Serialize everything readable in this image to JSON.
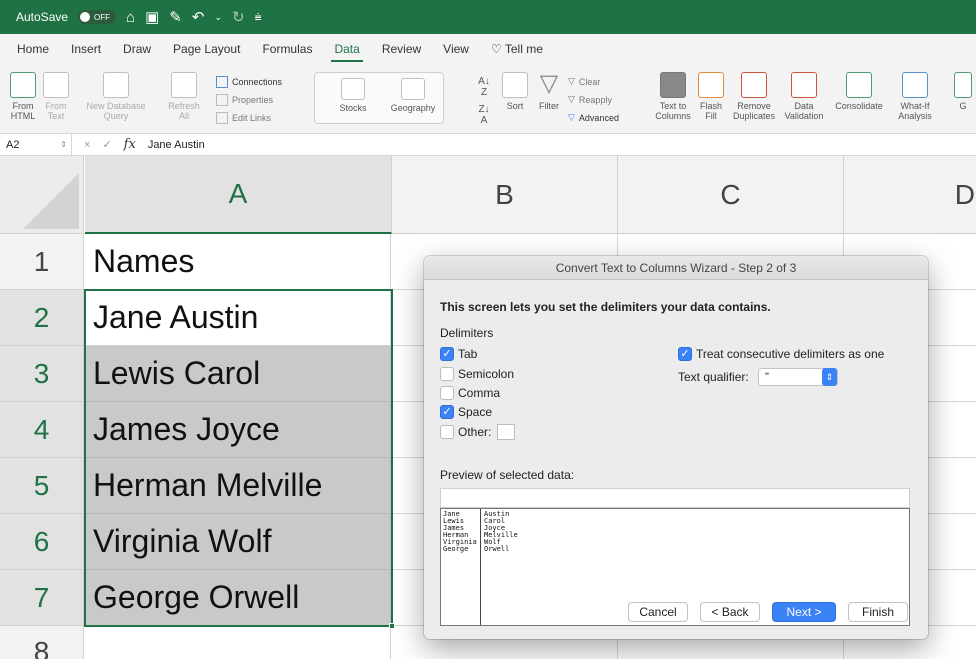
{
  "titlebar": {
    "autosave_label": "AutoSave",
    "autosave_state": "OFF",
    "icons": [
      "home-icon",
      "save-icon",
      "edit-icon",
      "undo-icon",
      "redo-icon",
      "customize-icon"
    ]
  },
  "ribbon_tabs": [
    {
      "label": "Home"
    },
    {
      "label": "Insert"
    },
    {
      "label": "Draw"
    },
    {
      "label": "Page Layout"
    },
    {
      "label": "Formulas"
    },
    {
      "label": "Data"
    },
    {
      "label": "Review"
    },
    {
      "label": "View"
    }
  ],
  "tell_me": "Tell me",
  "ribbon": {
    "from_html": [
      "From",
      "HTML"
    ],
    "from_text": [
      "From",
      "Text"
    ],
    "new_db_query": [
      "New Database",
      "Query"
    ],
    "refresh_all": [
      "Refresh",
      "All"
    ],
    "connections": "Connections",
    "properties": "Properties",
    "edit_links": "Edit Links",
    "stocks": "Stocks",
    "geography": "Geography",
    "sort": "Sort",
    "filter": "Filter",
    "clear": "Clear",
    "reapply": "Reapply",
    "advanced": "Advanced",
    "text_to_columns": [
      "Text to",
      "Columns"
    ],
    "flash_fill": [
      "Flash",
      "Fill"
    ],
    "remove_duplicates": [
      "Remove",
      "Duplicates"
    ],
    "data_validation": [
      "Data",
      "Validation"
    ],
    "consolidate": "Consolidate",
    "what_if": [
      "What-If",
      "Analysis"
    ],
    "cut_off": "G"
  },
  "formula_bar": {
    "name_box": "A2",
    "cancel_symbol": "×",
    "enter_symbol": "✓",
    "fx": "fx",
    "value": "Jane Austin"
  },
  "columns": [
    "A",
    "B",
    "C",
    "D"
  ],
  "rows": [
    "1",
    "2",
    "3",
    "4",
    "5",
    "6",
    "7",
    "8"
  ],
  "cells": [
    "Names",
    "Jane Austin",
    "Lewis Carol",
    "James Joyce",
    "Herman Melville",
    "Virginia Wolf",
    "George Orwell"
  ],
  "dialog": {
    "title": "Convert Text to Columns Wizard - Step 2 of 3",
    "heading": "This screen lets you set the delimiters your data contains.",
    "delimiters_label": "Delimiters",
    "tab": {
      "label": "Tab",
      "checked": true
    },
    "semicolon": {
      "label": "Semicolon",
      "checked": false
    },
    "comma": {
      "label": "Comma",
      "checked": false
    },
    "space": {
      "label": "Space",
      "checked": true
    },
    "other": {
      "label": "Other:",
      "checked": false
    },
    "treat_consecutive": {
      "label": "Treat consecutive delimiters as one",
      "checked": true
    },
    "text_qualifier_label": "Text qualifier:",
    "text_qualifier_value": "\"",
    "preview_label": "Preview of selected data:",
    "preview_col1": [
      "Jane",
      "Lewis",
      "James",
      "Herman",
      "Virginia",
      "George"
    ],
    "preview_col2": [
      "Austin",
      "Carol",
      "Joyce",
      "Melville",
      "Wolf",
      "Orwell"
    ],
    "buttons": {
      "cancel": "Cancel",
      "back": "< Back",
      "next": "Next >",
      "finish": "Finish"
    }
  },
  "colors": {
    "excel_green": "#1f7244",
    "mac_blue": "#3b82f6",
    "selection_gray": "#c9c9c9"
  }
}
